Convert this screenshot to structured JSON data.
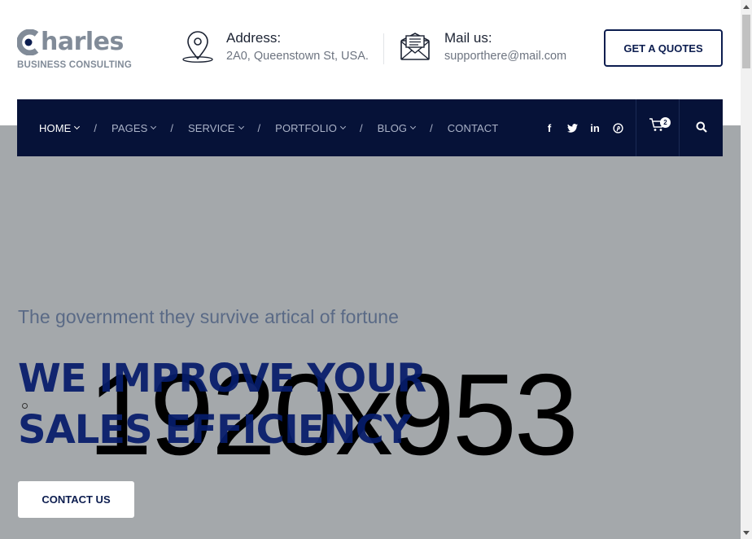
{
  "brand": {
    "name": "harles",
    "tagline": "BUSINESS CONSULTING",
    "color": "#818b98"
  },
  "header": {
    "address_title": "Address:",
    "address_text": "2A0, Queenstown St, USA.",
    "mail_title": "Mail us:",
    "mail_text": "supporthere@mail.com",
    "quote_button": "GET A QUOTES"
  },
  "nav": {
    "items": [
      {
        "label": "HOME",
        "dropdown": true,
        "active": true
      },
      {
        "label": "PAGES",
        "dropdown": true
      },
      {
        "label": "SERVICE",
        "dropdown": true
      },
      {
        "label": "PORTFOLIO",
        "dropdown": true
      },
      {
        "label": "BLOG",
        "dropdown": true
      },
      {
        "label": "CONTACT",
        "dropdown": false
      }
    ],
    "separator": "/",
    "social": {
      "facebook": "f",
      "twitter": "twitter-icon",
      "linkedin": "in",
      "pinterest": "pinterest-icon"
    },
    "cart_count": "2",
    "background": "#061238"
  },
  "hero": {
    "placeholder": "1920x953",
    "subtitle": "The government they survive artical of fortune",
    "headline_line1": "WE IMPROVE YOUR",
    "headline_line2": "SALES EFFICIENCY",
    "contact_button": "CONTACT US",
    "background": "#a4a8ab",
    "headline_color": "#061c6b"
  }
}
